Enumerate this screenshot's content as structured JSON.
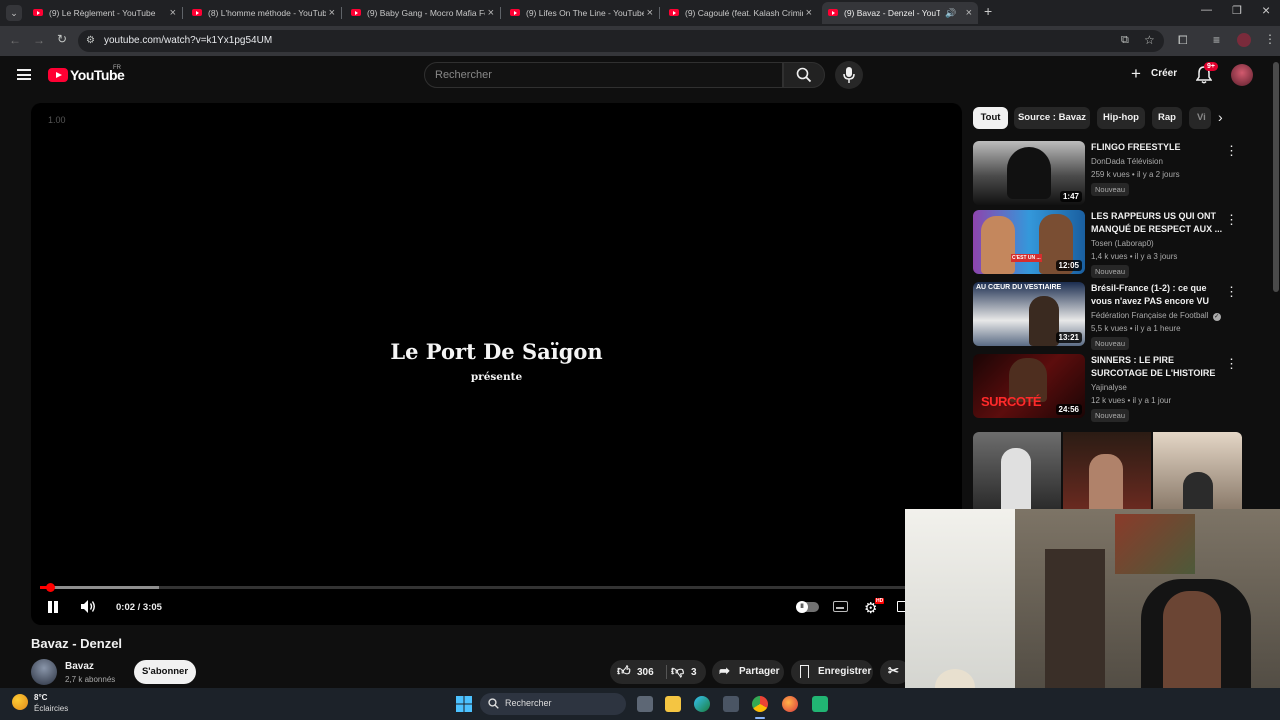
{
  "browser": {
    "tabs": [
      {
        "title": "(9) Le Règlement - YouTube",
        "active": false
      },
      {
        "title": "(8) L'homme méthode - YouTube",
        "active": false
      },
      {
        "title": "(9) Baby Gang - Mocro Mafia Fe",
        "active": false
      },
      {
        "title": "(9) Lifes On The Line - YouTube",
        "active": false
      },
      {
        "title": "(9) Cagoulé (feat. Kalash Crimin",
        "active": false
      },
      {
        "title": "(9) Bavaz - Denzel - YouTub",
        "active": true
      }
    ],
    "url": "youtube.com/watch?v=k1Yx1pg54UM"
  },
  "youtube": {
    "logo_text": "YouTube",
    "region": "FR",
    "search_placeholder": "Rechercher",
    "create_label": "Créer",
    "notif_count": "9+"
  },
  "player": {
    "overlay_value": "1.00",
    "intro_title": "Le Port De Saïgon",
    "intro_subtitle": "présente",
    "time": "0:02 / 3:05",
    "progress": 0.011,
    "buffered": 0.13,
    "settings_badge": "HD"
  },
  "video": {
    "title": "Bavaz - Denzel",
    "channel": "Bavaz",
    "subscribers": "2,7 k abonnés",
    "subscribe_label": "S'abonner",
    "likes": "306",
    "dislikes": "3",
    "share_label": "Partager",
    "save_label": "Enregistrer"
  },
  "sidebar": {
    "chips": [
      "Tout",
      "Source : Bavaz",
      "Hip-hop",
      "Rap",
      "Vi"
    ],
    "videos": [
      {
        "title": "FLINGO FREESTYLE",
        "channel": "DonDada Télévision",
        "meta": "259 k vues • il y a 2 jours",
        "badge": "Nouveau",
        "duration": "1:47",
        "verified": false
      },
      {
        "title": "LES RAPPEURS US QUI ONT MANQUÉ DE RESPECT AUX ...",
        "channel": "Tosen (Laborap0)",
        "meta": "1,4 k vues • il y a 3 jours",
        "badge": "Nouveau",
        "duration": "12:05",
        "verified": false
      },
      {
        "title": "Brésil-France (1-2) : ce que vous n'avez PAS encore VU",
        "channel": "Fédération Française de Football",
        "meta": "5,5 k vues • il y a 1 heure",
        "badge": "Nouveau",
        "duration": "13:21",
        "verified": true
      },
      {
        "title": "SINNERS : LE PIRE SURCOTAGE DE L'HISTOIRE",
        "channel": "Yajinalyse",
        "meta": "12 k vues • il y a 1 jour",
        "badge": "Nouveau",
        "duration": "24:56",
        "verified": false
      }
    ],
    "thumb_texts": [
      "C'EST UN ...",
      "AU CŒUR DU VESTIAIRE",
      "SURCOTÉ"
    ]
  },
  "taskbar": {
    "weather_temp": "8°C",
    "weather_desc": "Éclaircies",
    "search_label": "Rechercher"
  },
  "colors": {
    "youtube_red": "#ff0033",
    "background": "#0f0f0f",
    "chip_bg": "#272727"
  }
}
